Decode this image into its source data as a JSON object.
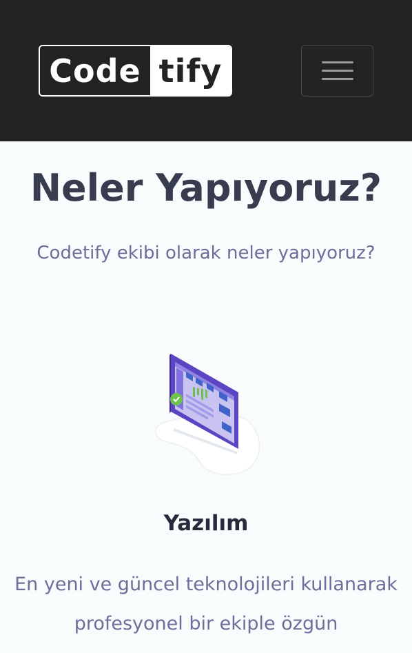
{
  "navbar": {
    "logo_part1": "Code",
    "logo_part2": "tify",
    "toggle_icon": "hamburger-menu-icon"
  },
  "section": {
    "title": "Neler Yapıyoruz?",
    "subtitle": "Codetify ekibi olarak neler yapıyoruz?"
  },
  "service": {
    "illustration": "software-screen-illustration",
    "title": "Yazılım",
    "description": "En yeni ve güncel teknolojileri kullanarak profesyonel bir ekiple özgün"
  },
  "colors": {
    "navbar_bg": "#232323",
    "heading": "#373c4f",
    "text_muted": "#6b6f9a",
    "accent_purple": "#6a4fc6",
    "accent_green": "#6cc24a"
  }
}
